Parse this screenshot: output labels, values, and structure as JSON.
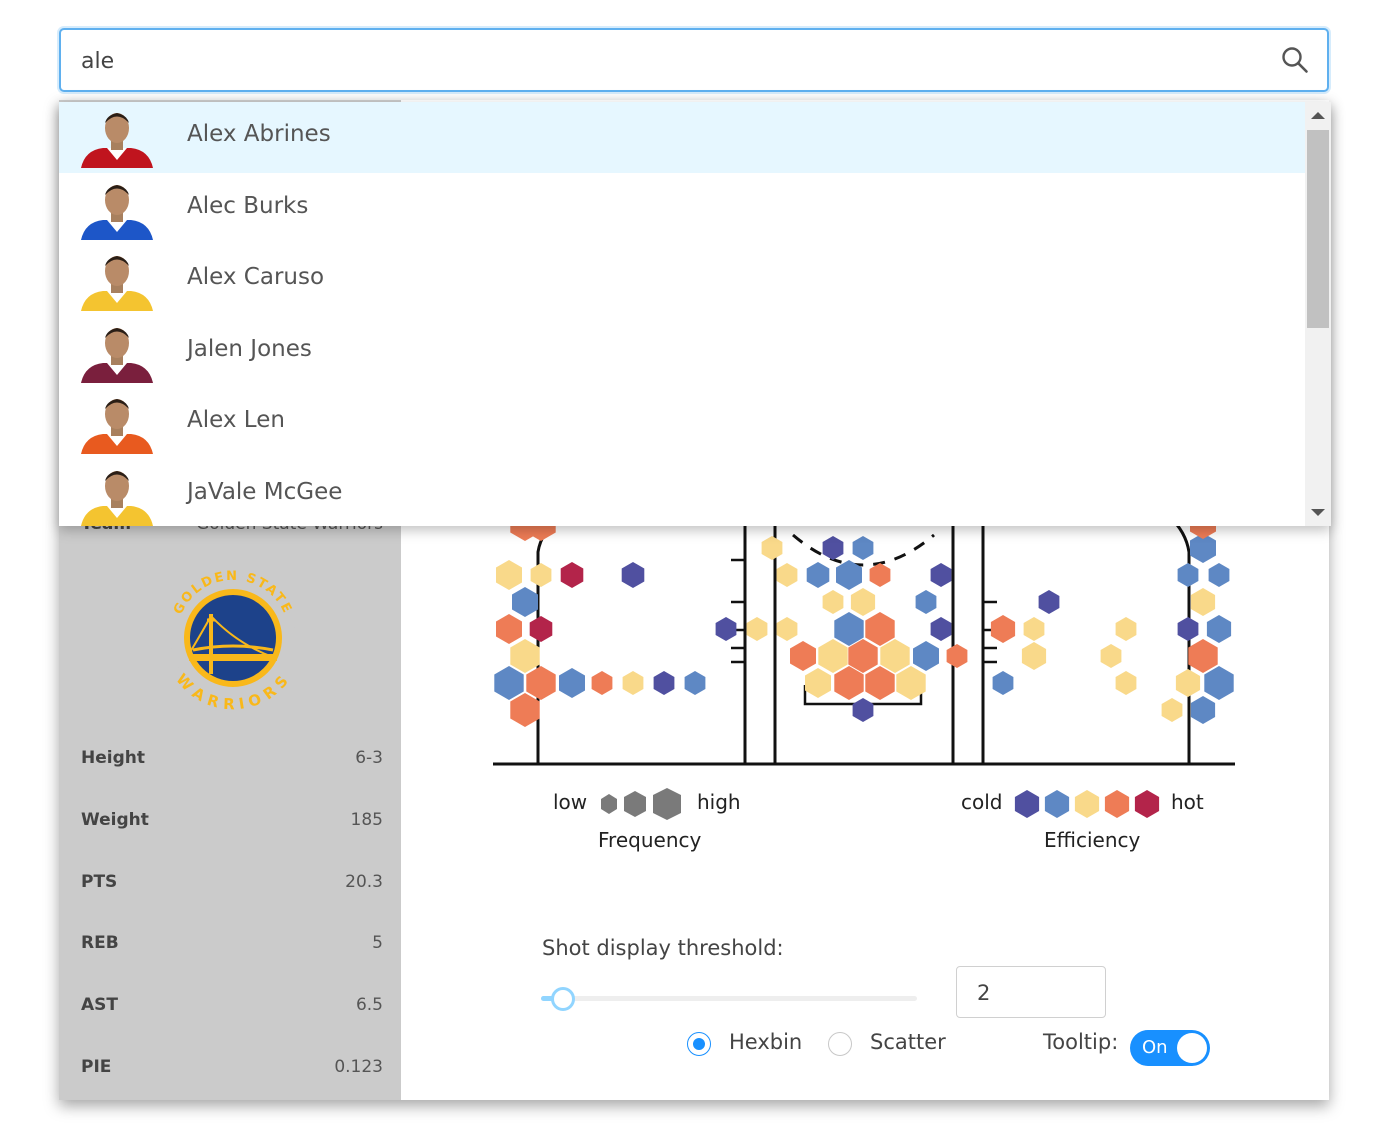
{
  "search": {
    "value": "ale"
  },
  "dropdown": {
    "options": [
      {
        "name": "Alex Abrines",
        "jersey": "#c0141e"
      },
      {
        "name": "Alec Burks",
        "jersey": "#1d56c8"
      },
      {
        "name": "Alex Caruso",
        "jersey": "#f4c430"
      },
      {
        "name": "Jalen Jones",
        "jersey": "#7a1f3d"
      },
      {
        "name": "Alex Len",
        "jersey": "#e85a1f"
      },
      {
        "name": "JaVale McGee",
        "jersey": "#f4c430"
      }
    ]
  },
  "player": {
    "team_label": "Team",
    "team_value": "Golden State Warriors",
    "logo_text": {
      "top": "GOLDEN STATE",
      "bottom": "WARRIORS"
    },
    "stats": [
      {
        "label": "Height",
        "value": "6-3"
      },
      {
        "label": "Weight",
        "value": "185"
      },
      {
        "label": "PTS",
        "value": "20.3"
      },
      {
        "label": "REB",
        "value": "5"
      },
      {
        "label": "AST",
        "value": "6.5"
      },
      {
        "label": "PIE",
        "value": "0.123"
      }
    ]
  },
  "legend": {
    "freq_low": "low",
    "freq_high": "high",
    "freq_title": "Frequency",
    "eff_cold": "cold",
    "eff_hot": "hot",
    "eff_title": "Efficiency",
    "eff_colors": [
      "#5050a0",
      "#5e88c4",
      "#f9d98a",
      "#ee7c56",
      "#b3244a"
    ]
  },
  "controls": {
    "threshold_label": "Shot display threshold:",
    "threshold_value": "2",
    "threshold_fraction": 0.05,
    "radio_hexbin": "Hexbin",
    "radio_scatter": "Scatter",
    "selected_mode": "Hexbin",
    "tooltip_label": "Tooltip:",
    "tooltip_state": "On"
  },
  "colors": {
    "accent": "#1890ff",
    "sidebar": "#cbcbcb",
    "highlight": "#e6f7ff"
  }
}
